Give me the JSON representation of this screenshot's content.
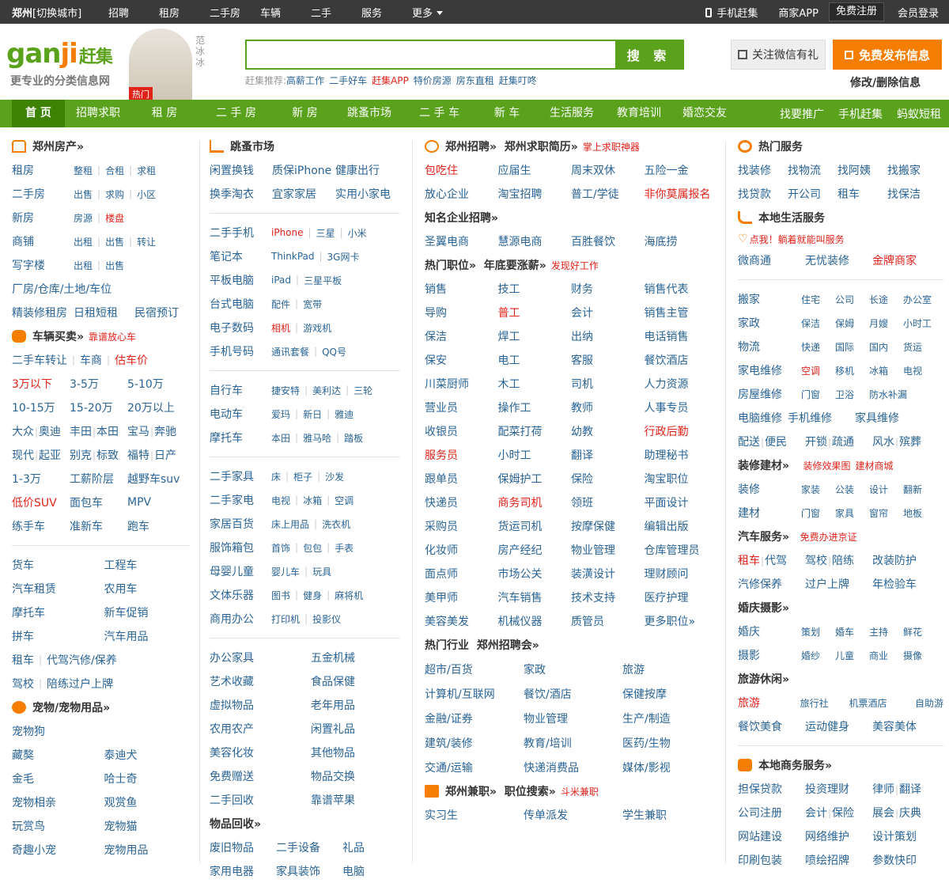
{
  "topbar": {
    "city": "郑州",
    "switch": "[切换城市]",
    "nav": [
      "招聘",
      "租房",
      "二手房",
      "车辆",
      "二手",
      "服务",
      "更多"
    ],
    "mobile": "手机赶集",
    "merchant": "商家APP",
    "register": "免费注册",
    "login": "会员登录"
  },
  "header": {
    "logo_a": "gan",
    "logo_b": "ji",
    "logo_c": "赶集",
    "slogan": "更专业的分类信息网",
    "star_name": "范冰冰",
    "hot": "热门",
    "search_btn": "搜 索",
    "rec_label": "赶集推荐:",
    "rec": [
      {
        "t": "高薪工作",
        "red": false
      },
      {
        "t": "二手好车",
        "red": false
      },
      {
        "t": "赶集APP",
        "red": true
      },
      {
        "t": "特价房源",
        "red": false
      },
      {
        "t": "房东直租",
        "red": false
      },
      {
        "t": "赶集叮咚",
        "red": false
      }
    ],
    "wechat": "关注微信有礼",
    "post": "免费发布信息",
    "modify": "修改/删除信息"
  },
  "mainnav": {
    "items": [
      "首 页",
      "招聘求职",
      "租 房",
      "二 手 房",
      "新 房",
      "跳蚤市场",
      "二 手 车",
      "新 车",
      "生活服务",
      "教育培训",
      "婚恋交友"
    ],
    "right": [
      "找要推广",
      "手机赶集",
      "蚂蚁短租"
    ]
  },
  "col1": {
    "house_title": "郑州房产»",
    "house": [
      [
        "租房",
        "整租",
        "合租",
        "求租"
      ],
      [
        "二手房",
        "出售",
        "求购",
        "小区"
      ],
      [
        "新房",
        "房源",
        "楼盘"
      ],
      [
        "商铺",
        "出租",
        "出售",
        "转让"
      ],
      [
        "写字楼",
        "出租",
        "出售"
      ]
    ],
    "house_extra": [
      "厂房/仓库/土地/车位"
    ],
    "house_extra2": [
      "精装修租房",
      "日租短租",
      "民宿预订"
    ],
    "car_title": "车辆买卖»",
    "car_tag": "靠谱放心车",
    "car_row1": [
      "二手车转让",
      "车商",
      "估车价"
    ],
    "car_grid": [
      [
        "3万以下",
        "3-5万",
        "5-10万"
      ],
      [
        "10-15万",
        "15-20万",
        "20万以上"
      ],
      [
        "大众",
        "奥迪",
        "丰田",
        "本田",
        "宝马",
        "奔驰"
      ],
      [
        "现代",
        "起亚",
        "别克",
        "标致",
        "福特",
        "日产"
      ],
      [
        "1-3万",
        "工薪阶层",
        "越野车suv"
      ],
      [
        "低价SUV",
        "面包车",
        "MPV"
      ],
      [
        "练手车",
        "准新车",
        "跑车"
      ]
    ],
    "car2": [
      [
        "货车",
        "工程车"
      ],
      [
        "汽车租赁",
        "农用车"
      ],
      [
        "摩托车",
        "新车促销"
      ],
      [
        "拼车",
        "汽车用品"
      ],
      [
        "租车",
        "代驾",
        "汽修/保养"
      ],
      [
        "驾校",
        "陪练",
        "过户上牌"
      ]
    ],
    "pet_title": "宠物/宠物用品»",
    "pet": [
      [
        "宠物狗",
        ""
      ],
      [
        "藏獒",
        "泰迪犬"
      ],
      [
        "金毛",
        "哈士奇"
      ],
      [
        "宠物相亲",
        "观赏鱼"
      ],
      [
        "玩赏鸟",
        "宠物猫"
      ],
      [
        "奇趣小宠",
        "宠物用品"
      ]
    ]
  },
  "col2": {
    "title": "跳蚤市场",
    "rows1": [
      [
        "闲置换钱",
        "质保iPhone",
        "健康出行"
      ],
      [
        "换季淘衣",
        "宜家家居",
        "实用小家电"
      ]
    ],
    "rows2": [
      [
        "二手手机",
        "iPhone",
        "三星",
        "小米"
      ],
      [
        "笔记本",
        "ThinkPad",
        "3G网卡"
      ],
      [
        "平板电脑",
        "iPad",
        "三星平板"
      ],
      [
        "台式电脑",
        "配件",
        "宽带"
      ],
      [
        "电子数码",
        "相机",
        "游戏机"
      ],
      [
        "手机号码",
        "通讯套餐",
        "QQ号"
      ]
    ],
    "rows3": [
      [
        "自行车",
        "捷安特",
        "美利达",
        "三轮"
      ],
      [
        "电动车",
        "爱玛",
        "新日",
        "雅迪"
      ],
      [
        "摩托车",
        "本田",
        "雅马哈",
        "踏板"
      ]
    ],
    "rows4": [
      [
        "二手家具",
        "床",
        "柜子",
        "沙发"
      ],
      [
        "二手家电",
        "电视",
        "冰箱",
        "空调"
      ],
      [
        "家居百货",
        "床上用品",
        "洗衣机"
      ],
      [
        "服饰箱包",
        "首饰",
        "包包",
        "手表"
      ],
      [
        "母婴儿童",
        "婴儿车",
        "玩具"
      ],
      [
        "文体乐器",
        "图书",
        "健身",
        "麻将机"
      ],
      [
        "商用办公",
        "打印机",
        "投影仪"
      ]
    ],
    "rows5": [
      [
        "办公家具",
        "五金机械"
      ],
      [
        "艺术收藏",
        "食品保健"
      ],
      [
        "虚拟物品",
        "老年用品"
      ],
      [
        "农用农产",
        "闲置礼品"
      ],
      [
        "美容化妆",
        "其他物品"
      ],
      [
        "免费赠送",
        "物品交换"
      ],
      [
        "二手回收",
        "靠谱苹果"
      ]
    ],
    "recycle_title": "物品回收»",
    "rows6": [
      [
        "废旧物品",
        "二手设备",
        "礼品"
      ],
      [
        "家用电器",
        "家具装饰",
        "电脑"
      ]
    ]
  },
  "col3": {
    "job_title": "郑州招聘»",
    "job_title2": "郑州求职简历»",
    "job_tag": "掌上求职神器",
    "job1": [
      [
        "包吃住",
        "应届生",
        "周末双休",
        "五险一金"
      ],
      [
        "放心企业",
        "淘宝招聘",
        "普工/学徒",
        "非你莫属报名"
      ]
    ],
    "corp_title": "知名企业招聘»",
    "corp": [
      "圣翼电商",
      "慧源电商",
      "百胜餐饮",
      "海底捞"
    ],
    "hot_title": "热门职位»",
    "hot_title2": "年底要涨薪»",
    "hot_tag": "发现好工作",
    "jobs": [
      [
        "销售",
        "技工",
        "财务",
        "销售代表"
      ],
      [
        "导购",
        "普工",
        "会计",
        "销售主管"
      ],
      [
        "保洁",
        "焊工",
        "出纳",
        "电话销售"
      ],
      [
        "保安",
        "电工",
        "客服",
        "餐饮酒店"
      ],
      [
        "川菜厨师",
        "木工",
        "司机",
        "人力资源"
      ],
      [
        "营业员",
        "操作工",
        "教师",
        "人事专员"
      ],
      [
        "收银员",
        "配菜打荷",
        "幼教",
        "行政后勤"
      ],
      [
        "服务员",
        "小时工",
        "翻译",
        "助理秘书"
      ],
      [
        "跟单员",
        "保姆护工",
        "保险",
        "淘宝职位"
      ],
      [
        "快递员",
        "商务司机",
        "领班",
        "平面设计"
      ],
      [
        "采购员",
        "货运司机",
        "按摩保健",
        "编辑出版"
      ],
      [
        "化妆师",
        "房产经纪",
        "物业管理",
        "仓库管理员"
      ],
      [
        "面点师",
        "市场公关",
        "装潢设计",
        "理财顾问"
      ],
      [
        "美甲师",
        "汽车销售",
        "技术支持",
        "医疗护理"
      ],
      [
        "美容美发",
        "机械仪器",
        "质管员",
        "更多职位»"
      ]
    ],
    "ind_title": "热门行业",
    "ind_title2": "郑州招聘会»",
    "ind": [
      [
        "超市/百货",
        "家政",
        "旅游"
      ],
      [
        "计算机/互联网",
        "餐饮/酒店",
        "保健按摩"
      ],
      [
        "金融/证券",
        "物业管理",
        "生产/制造"
      ],
      [
        "建筑/装修",
        "教育/培训",
        "医药/生物"
      ],
      [
        "交通/运输",
        "快递消费品",
        "媒体/影视"
      ]
    ],
    "part_title": "郑州兼职»",
    "part_title2": "职位搜索»",
    "part_tag": "斗米兼职",
    "part": [
      "实习生",
      "传单派发",
      "学生兼职"
    ]
  },
  "col4": {
    "hot_title": "热门服务",
    "hot": [
      [
        "找装修",
        "找物流",
        "找阿姨",
        "找搬家"
      ],
      [
        "找贷款",
        "开公司",
        "租车",
        "找保洁"
      ]
    ],
    "life_title": "本地生活服务",
    "life_tag": "点我！躺着就能叫服务",
    "life_row": [
      "微商通",
      "无忧装修",
      "金牌商家"
    ],
    "life": [
      [
        "搬家",
        "住宅",
        "公司",
        "长途",
        "办公室"
      ],
      [
        "家政",
        "保洁",
        "保姆",
        "月嫂",
        "小时工"
      ],
      [
        "物流",
        "快递",
        "国际",
        "国内",
        "货运"
      ],
      [
        "家电维修",
        "空调",
        "移机",
        "冰箱",
        "电视"
      ],
      [
        "房屋维修",
        "门窗",
        "卫浴",
        "防水补漏"
      ],
      [
        "电脑维修",
        "手机维修",
        "家具维修"
      ],
      [
        "配送",
        "便民",
        "开锁",
        "疏通",
        "风水",
        "殡葬"
      ]
    ],
    "deco_title": "装修建材»",
    "deco_tag1": "装修效果图",
    "deco_tag2": "建材商城",
    "deco": [
      [
        "装修",
        "家装",
        "公装",
        "设计",
        "翻新"
      ],
      [
        "建材",
        "门窗",
        "家具",
        "窗帘",
        "地板"
      ]
    ],
    "auto_title": "汽车服务»",
    "auto_tag": "免费办进京证",
    "auto": [
      [
        "租车",
        "代驾",
        "驾校",
        "陪练",
        "改装防护"
      ],
      [
        "汽修保养",
        "过户上牌",
        "年检验车"
      ]
    ],
    "wed_title": "婚庆摄影»",
    "wed": [
      [
        "婚庆",
        "策划",
        "婚车",
        "主持",
        "鲜花"
      ],
      [
        "摄影",
        "婚纱",
        "儿童",
        "商业",
        "摄像"
      ]
    ],
    "tour_title": "旅游休闲»",
    "tour": [
      [
        "旅游",
        "旅行社",
        "机票酒店",
        "自助游"
      ],
      [
        "餐饮美食",
        "运动健身",
        "美容美体"
      ]
    ],
    "biz_title": "本地商务服务»",
    "biz": [
      [
        "担保贷款",
        "投资理财",
        "律师",
        "翻译"
      ],
      [
        "公司注册",
        "会计",
        "保险",
        "展会",
        "庆典"
      ],
      [
        "网站建设",
        "网络维护",
        "设计策划"
      ],
      [
        "印刷包装",
        "喷绘招牌",
        "参数快印"
      ]
    ]
  }
}
